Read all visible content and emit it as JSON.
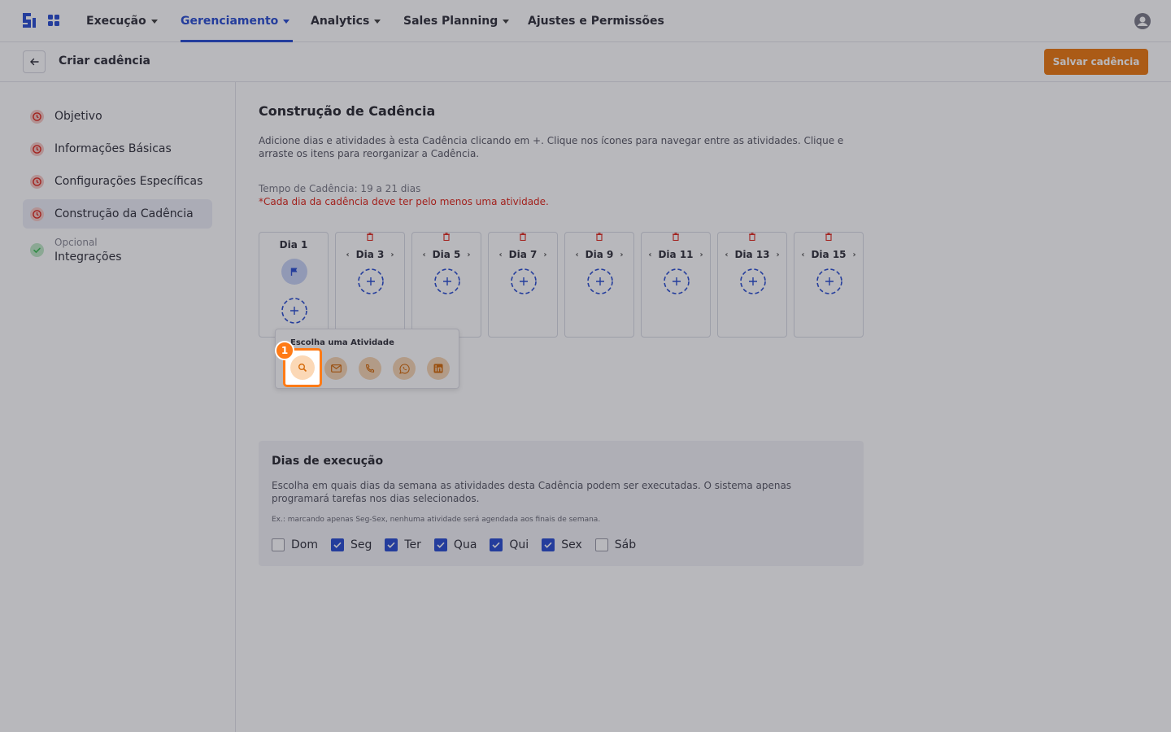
{
  "nav": {
    "items": [
      {
        "label": "Execução"
      },
      {
        "label": "Gerenciamento"
      },
      {
        "label": "Analytics"
      },
      {
        "label": "Sales Planning"
      },
      {
        "label": "Ajustes e Permissões"
      }
    ],
    "active": "Gerenciamento"
  },
  "header": {
    "title": "Criar cadência",
    "save_label": "Salvar cadência"
  },
  "sidebar": {
    "steps": [
      {
        "label": "Objetivo",
        "status": "error"
      },
      {
        "label": "Informações Básicas",
        "status": "error"
      },
      {
        "label": "Configurações Específicas",
        "status": "error"
      },
      {
        "label": "Construção da Cadência",
        "status": "error"
      },
      {
        "sub": "Opcional",
        "label": "Integrações",
        "status": "done"
      }
    ]
  },
  "main": {
    "title": "Construção de Cadência",
    "description": "Adicione dias e atividades à esta Cadência clicando em +. Clique nos ícones para navegar entre as atividades. Clique e arraste os itens para reorganizar a Cadência.",
    "time_info": "Tempo de Cadência: 19 a 21 dias",
    "warning": "*Cada dia da cadência deve ter pelo menos uma atividade.",
    "days": [
      {
        "label": "Dia 1"
      },
      {
        "label": "Dia 3"
      },
      {
        "label": "Dia 5"
      },
      {
        "label": "Dia 7"
      },
      {
        "label": "Dia 9"
      },
      {
        "label": "Dia 11"
      },
      {
        "label": "Dia 13"
      },
      {
        "label": "Dia 15"
      }
    ],
    "popup": {
      "title": "Escolha uma Atividade",
      "actions": [
        "search-icon",
        "mail-icon",
        "phone-icon",
        "whatsapp-icon",
        "linkedin-icon"
      ]
    },
    "step_badge": "1"
  },
  "execution": {
    "title": "Dias de execução",
    "description": "Escolha em quais dias da semana as atividades desta Cadência podem ser executadas. O sistema apenas programará tarefas nos dias selecionados.",
    "example": "Ex.: marcando apenas Seg-Sex, nenhuma atividade será agendada aos finais de semana.",
    "weekdays": [
      {
        "label": "Dom",
        "checked": false
      },
      {
        "label": "Seg",
        "checked": true
      },
      {
        "label": "Ter",
        "checked": true
      },
      {
        "label": "Qua",
        "checked": true
      },
      {
        "label": "Qui",
        "checked": true
      },
      {
        "label": "Sex",
        "checked": true
      },
      {
        "label": "Sáb",
        "checked": false
      }
    ]
  },
  "colors": {
    "primary": "#2c4fd1",
    "accent": "#ec7a12",
    "error": "#e0281c",
    "success": "#3fbf57"
  }
}
